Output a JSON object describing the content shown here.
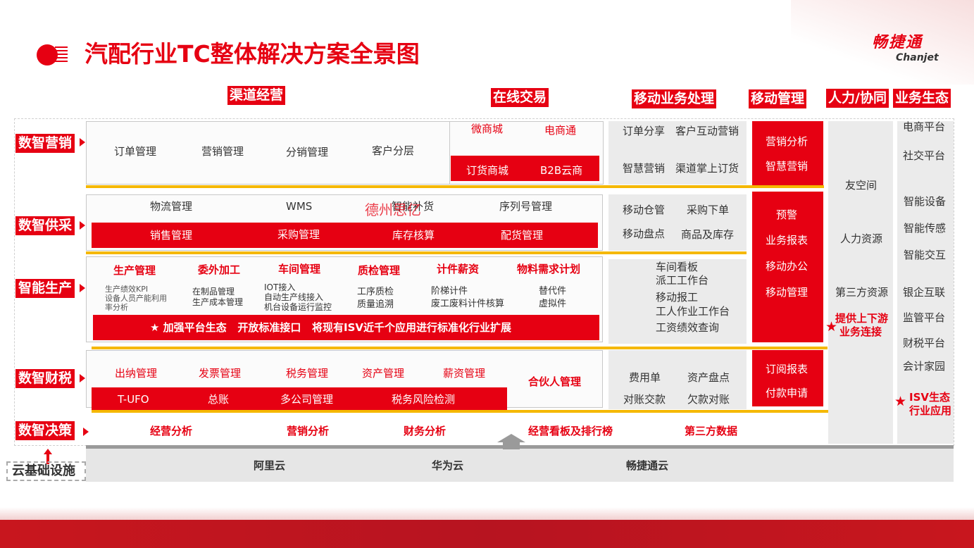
{
  "title": "汽配行业TC整体解决方案全景图",
  "brand": {
    "cn": "畅捷通",
    "en": "Chanjet"
  },
  "colors": {
    "accent": "#e60012",
    "yellow": "#f5b800",
    "gray_panel": "#e9e9e9",
    "footer": "#c41020"
  },
  "headers": [
    "渠道经营",
    "在线交易",
    "移动业务处理",
    "移动管理",
    "人力/协同",
    "业务生态"
  ],
  "row_labels": [
    "数智营销",
    "数智供采",
    "智能生产",
    "数智财税",
    "数智决策",
    "云基础设施"
  ],
  "marketing": {
    "items": [
      "订单管理",
      "营销管理",
      "分销管理",
      "客户分层"
    ],
    "online": [
      "微商城",
      "电商通"
    ],
    "online_bar": [
      "订货商城",
      "B2B云商"
    ],
    "mobile": [
      "订单分享",
      "客户互动营销",
      "智慧营销",
      "渠道掌上订货"
    ],
    "mgmt": [
      "营销分析",
      "智慧营销"
    ]
  },
  "supply": {
    "items": [
      "物流管理",
      "WMS",
      "智能补货",
      "序列号管理"
    ],
    "bar": [
      "销售管理",
      "采购管理",
      "库存核算",
      "配货管理"
    ],
    "watermark": "德州思亿",
    "mobile": [
      "移动仓管",
      "采购下单",
      "移动盘点",
      "商品及库存"
    ]
  },
  "production": {
    "heads": [
      "生产管理",
      "委外加工",
      "车间管理",
      "质检管理",
      "计件薪资",
      "物料需求计划"
    ],
    "sub1": [
      "生产绩效KPI",
      "设备人员产能利用",
      "率分析"
    ],
    "sub2": [
      "在制品管理",
      "生产成本管理"
    ],
    "sub3": [
      "IOT接入",
      "自动生产线接入",
      "机台设备运行监控"
    ],
    "sub4": [
      "工序质检",
      "质量追溯"
    ],
    "sub5": [
      "阶梯计件",
      "废工废料计件核算"
    ],
    "sub6": [
      "替代件",
      "虚拟件"
    ],
    "banner": "★ 加强平台生态   开放标准接口   将现有ISV近千个应用进行标准化行业扩展",
    "mobile": [
      "车间看板",
      "派工工作台",
      "移动报工",
      "工人作业工作台",
      "工资绩效查询"
    ]
  },
  "mgmt_mid": [
    "预警",
    "业务报表",
    "移动办公",
    "移动管理"
  ],
  "finance": {
    "items": [
      "出纳管理",
      "发票管理",
      "税务管理",
      "资产管理",
      "薪资管理"
    ],
    "partner": "合伙人管理",
    "bar": [
      "T-UFO",
      "总账",
      "多公司管理",
      "税务风险检测"
    ],
    "mobile": [
      "费用单",
      "资产盘点",
      "对账交款",
      "欠款对账"
    ],
    "mgmt": [
      "订阅报表",
      "付款申请"
    ]
  },
  "decision": [
    "经营分析",
    "营销分析",
    "财务分析",
    "经营看板及排行榜",
    "第三方数据"
  ],
  "cloud": [
    "阿里云",
    "华为云",
    "畅捷通云"
  ],
  "hr": [
    "友空间",
    "人力资源",
    "第三方资源"
  ],
  "hr_star": [
    "提供上下游",
    "业务连接"
  ],
  "eco": [
    "电商平台",
    "社交平台",
    "智能设备",
    "智能传感",
    "智能交互",
    "银企互联",
    "监管平台",
    "财税平台",
    "会计家园"
  ],
  "eco_star": [
    "ISV生态",
    "行业应用"
  ]
}
